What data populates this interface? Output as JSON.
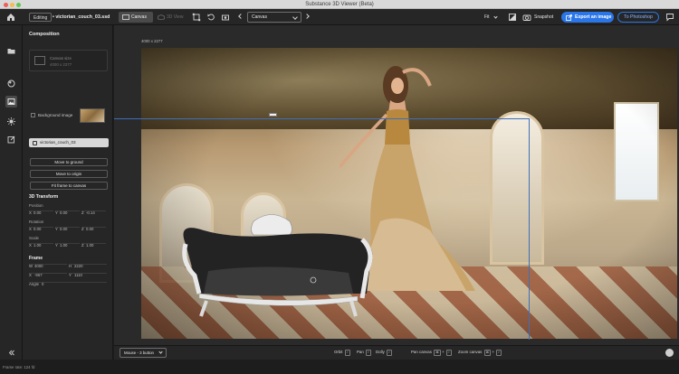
{
  "window": {
    "title": "Substance 3D Viewer (Beta)"
  },
  "toolbar": {
    "editing_label": "Editing",
    "file_name": "• victorian_couch_03.ssd",
    "tabs": [
      {
        "label": "Canvas",
        "active": true
      },
      {
        "label": "3D View",
        "active": false
      }
    ],
    "canvas_dropdown": "Canvas",
    "fit_label": "Fit",
    "snapshot_label": "Snapshot",
    "export_label": "Export an image",
    "photoshop_label": "To Photoshop"
  },
  "panel": {
    "title": "Composition",
    "canvas_size_label": "Canvas size",
    "canvas_size_value": "4000 x 2277",
    "background_image_label": "Background image",
    "object_name": "victorian_couch_03",
    "buttons": {
      "move_to_ground": "Move to ground",
      "move_to_origin": "Move to origin",
      "fit_frame": "Fit frame to canvas"
    },
    "transform": {
      "title": "3D Transform",
      "position_label": "Position",
      "position": {
        "x": "0.00",
        "y": "0.00",
        "z": "-0.14"
      },
      "rotation_label": "Rotation",
      "rotation": {
        "x": "0.00",
        "y": "0.00",
        "z": "0.00"
      },
      "scale_label": "Scale",
      "scale": {
        "x": "1.00",
        "y": "1.00",
        "z": "1.00"
      }
    },
    "frame": {
      "title": "Frame",
      "w": "4000",
      "h": "2220",
      "x": "-967",
      "y": "1110",
      "angle": "0"
    }
  },
  "canvas": {
    "dimensions": "4000 x 2277"
  },
  "bottom_toolbar": {
    "mouse_mode": "Mouse - 3 button",
    "orbit": "Orbit",
    "pan": "Pan",
    "dolly": "Dolly",
    "pan_canvas": "Pan canvas",
    "zoom_canvas": "Zoom canvas"
  },
  "status": {
    "frame_rate": "Frame rate: 124 fd"
  },
  "colors": {
    "accent": "#2a75e8",
    "guide": "#3f6fb7",
    "panel_bg": "#262626"
  }
}
